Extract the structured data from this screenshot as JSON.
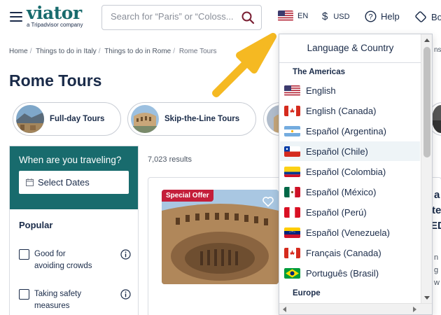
{
  "header": {
    "logo": "viator",
    "logo_sub": "a Tripadvisor company",
    "search_placeholder": "Search for “Paris” or “Coloss...",
    "language": "EN",
    "currency_symbol": "$",
    "currency": "USD",
    "help": "Help",
    "bookings_partial": "Bo"
  },
  "breadcrumb": [
    "Home",
    "Things to do in Italy",
    "Things to do in Rome",
    "Rome Tours"
  ],
  "page_title": "Rome Tours",
  "chips": [
    {
      "label": "Full-day Tours"
    },
    {
      "label": "Skip-the-Line Tours"
    }
  ],
  "sidebar": {
    "when_title": "When are you traveling?",
    "date_button": "Select Dates",
    "popular_title": "Popular",
    "filters": [
      {
        "label": "Good for avoiding crowds"
      },
      {
        "label": "Taking safety measures"
      }
    ]
  },
  "results": {
    "count": "7,023 results",
    "card_badge": "Special Offer"
  },
  "cutoff": {
    "right_top": "ns?",
    "right_a": "a",
    "right_b": "te",
    "right_c": "ED",
    "right_d": "n",
    "right_e": "g",
    "right_f": "w"
  },
  "dropdown": {
    "title": "Language & Country",
    "sections": [
      {
        "name": "The Americas",
        "items": [
          {
            "label": "English",
            "flag": "us"
          },
          {
            "label": "English (Canada)",
            "flag": "ca"
          },
          {
            "label": "Español (Argentina)",
            "flag": "ar"
          },
          {
            "label": "Español (Chile)",
            "flag": "cl",
            "selected": true
          },
          {
            "label": "Español (Colombia)",
            "flag": "co"
          },
          {
            "label": "Español (México)",
            "flag": "mx"
          },
          {
            "label": "Español (Perú)",
            "flag": "pe"
          },
          {
            "label": "Español (Venezuela)",
            "flag": "ve"
          },
          {
            "label": "Français (Canada)",
            "flag": "ca"
          },
          {
            "label": "Português (Brasil)",
            "flag": "br"
          }
        ]
      },
      {
        "name": "Europe",
        "items": []
      }
    ]
  },
  "colors": {
    "brand": "#186b6d",
    "text": "#1a2b49",
    "badge": "#c41e3a",
    "arrow": "#f5b922"
  }
}
